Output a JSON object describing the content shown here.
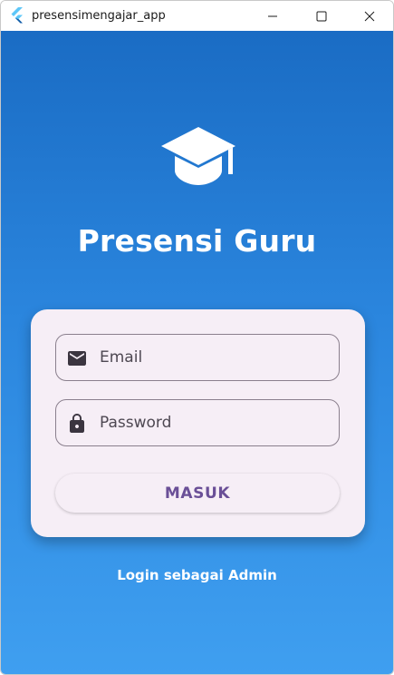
{
  "window": {
    "title": "presensimengajar_app",
    "app_icon": "flutter-icon",
    "controls": {
      "minimize_icon": "minimize-icon",
      "maximize_icon": "maximize-icon",
      "close_icon": "close-icon"
    }
  },
  "login": {
    "logo_icon": "graduation-cap-icon",
    "title": "Presensi Guru",
    "email": {
      "icon": "email-icon",
      "placeholder": "Email",
      "value": ""
    },
    "password": {
      "icon": "lock-icon",
      "placeholder": "Password",
      "value": ""
    },
    "submit_label": "MASUK",
    "admin_link_label": "Login sebagai Admin"
  },
  "colors": {
    "background_top": "#1a6cc4",
    "background_bottom": "#3f9ff0",
    "card": "#f6eef6",
    "button_text": "#6a4f97",
    "field_border": "#8a7f8d"
  }
}
